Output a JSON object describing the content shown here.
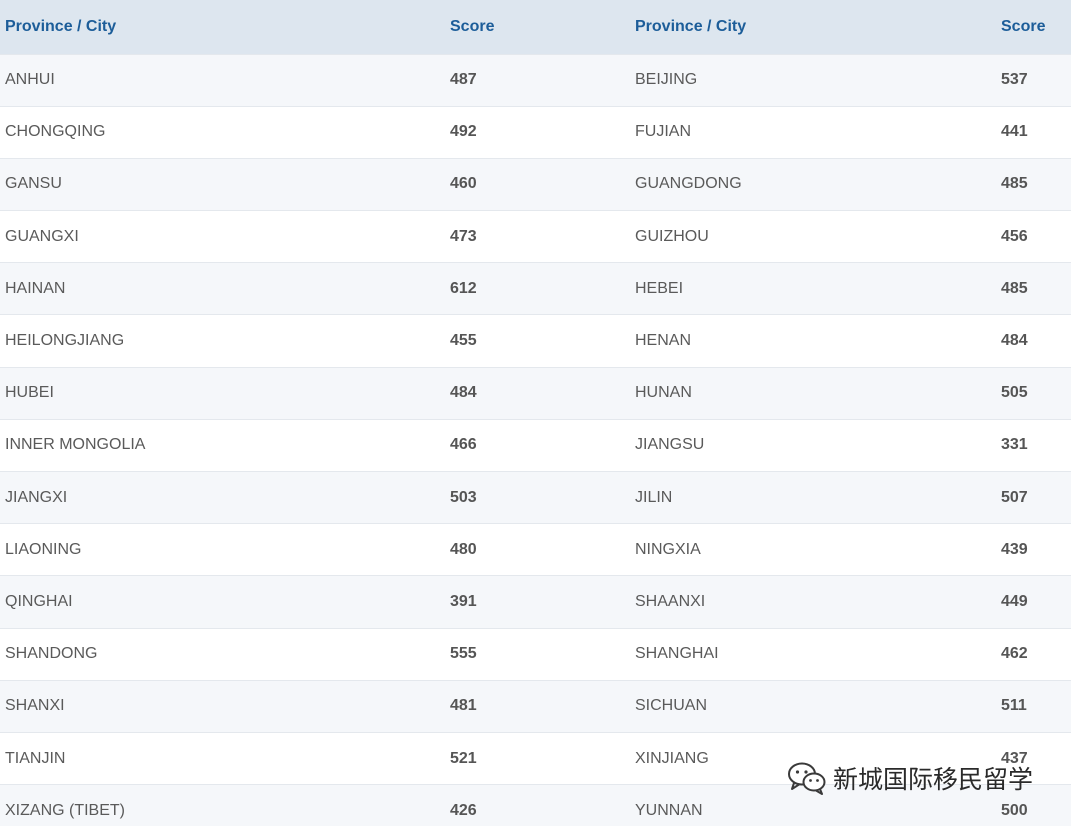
{
  "headers": {
    "province_city": "Province / City",
    "score": "Score"
  },
  "rows": [
    {
      "left_name": "ANHUI",
      "left_score": "487",
      "right_name": "BEIJING",
      "right_score": "537"
    },
    {
      "left_name": "CHONGQING",
      "left_score": "492",
      "right_name": "FUJIAN",
      "right_score": "441"
    },
    {
      "left_name": "GANSU",
      "left_score": "460",
      "right_name": "GUANGDONG",
      "right_score": "485"
    },
    {
      "left_name": "GUANGXI",
      "left_score": "473",
      "right_name": "GUIZHOU",
      "right_score": "456"
    },
    {
      "left_name": "HAINAN",
      "left_score": "612",
      "right_name": "HEBEI",
      "right_score": "485"
    },
    {
      "left_name": "HEILONGJIANG",
      "left_score": "455",
      "right_name": "HENAN",
      "right_score": "484"
    },
    {
      "left_name": "HUBEI",
      "left_score": "484",
      "right_name": "HUNAN",
      "right_score": "505"
    },
    {
      "left_name": "INNER MONGOLIA",
      "left_score": "466",
      "right_name": "JIANGSU",
      "right_score": "331"
    },
    {
      "left_name": "JIANGXI",
      "left_score": "503",
      "right_name": "JILIN",
      "right_score": "507"
    },
    {
      "left_name": "LIAONING",
      "left_score": "480",
      "right_name": "NINGXIA",
      "right_score": "439"
    },
    {
      "left_name": "QINGHAI",
      "left_score": "391",
      "right_name": "SHAANXI",
      "right_score": "449"
    },
    {
      "left_name": "SHANDONG",
      "left_score": "555",
      "right_name": "SHANGHAI",
      "right_score": "462"
    },
    {
      "left_name": "SHANXI",
      "left_score": "481",
      "right_name": "SICHUAN",
      "right_score": "511"
    },
    {
      "left_name": "TIANJIN",
      "left_score": "521",
      "right_name": "XINJIANG",
      "right_score": "437"
    },
    {
      "left_name": "XIZANG (TIBET)",
      "left_score": "426",
      "right_name": "YUNNAN",
      "right_score": "500"
    }
  ],
  "watermark": {
    "text": "新城国际移民留学",
    "icon": "wechat-icon"
  },
  "colors": {
    "header_bg": "#dde6ef",
    "header_text": "#1c5d99",
    "row_alt_bg": "#f5f7fa"
  }
}
